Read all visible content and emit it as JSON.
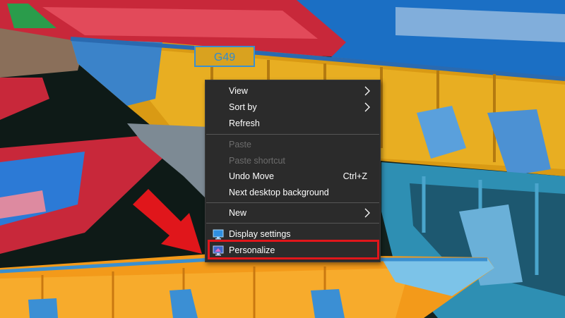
{
  "context_menu": {
    "items": [
      {
        "label": "View",
        "submenu": true
      },
      {
        "label": "Sort by",
        "submenu": true
      },
      {
        "label": "Refresh"
      },
      {
        "label": "Paste",
        "disabled": true
      },
      {
        "label": "Paste shortcut",
        "disabled": true
      },
      {
        "label": "Undo Move",
        "shortcut": "Ctrl+Z"
      },
      {
        "label": "Next desktop background"
      },
      {
        "label": "New",
        "submenu": true
      },
      {
        "label": "Display settings",
        "icon": "display-settings-icon"
      },
      {
        "label": "Personalize",
        "icon": "personalize-icon"
      }
    ]
  },
  "wallpaper": {
    "boat_registration": "G49"
  },
  "annotation": {
    "highlight_target": "Personalize",
    "arrow_color": "#e0161b"
  },
  "colors": {
    "menu_background": "#2b2b2b",
    "menu_text": "#ffffff",
    "menu_disabled_text": "#6d6d6d",
    "separator": "#565656",
    "highlight_border": "#e0161b"
  }
}
